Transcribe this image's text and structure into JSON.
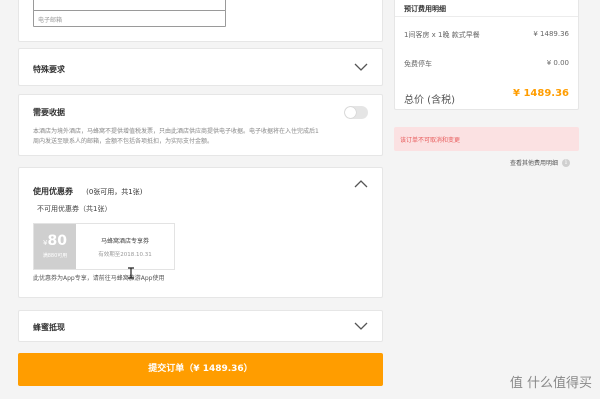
{
  "contact": {
    "email_placeholder": "电子邮箱"
  },
  "special": {
    "title": "特殊要求"
  },
  "receipt": {
    "title": "需要收据",
    "note_line1": "本酒店为境外酒店，马蜂窝不提供增值税发票，只由此酒店供应商提供电子收据。电子收据将在入住完成后1",
    "note_line2": "周内发送至联系人的邮箱，金额不包括各项抵扣，为实际支付金额。"
  },
  "coupon": {
    "title": "使用优惠券",
    "count": "(0张可用，共1张)",
    "unavailable_label": "不可用优惠券（共1张）",
    "ticket_currency": "¥",
    "ticket_amount": "80",
    "ticket_condition": "满880可用",
    "ticket_name": "马蜂窝酒店专享券",
    "ticket_expiry": "有效期至2018.10.31",
    "note": "此优惠券为App专享，请前往马蜂窝旅游App使用"
  },
  "bee": {
    "title": "蜂蜜抵现"
  },
  "submit": {
    "label": "提交订单（¥ 1489.36）"
  },
  "summary": {
    "header": "预订费用明细",
    "room_label": "1间客房 x 1晚  款式早餐",
    "room_price": "¥ 1489.36",
    "parking_label": "免费停车",
    "parking_price": "¥ 0.00",
    "total_label": "总价 (含税)",
    "total_price": "¥ 1489.36",
    "see_other": "查看其他费用明细",
    "info_icon": "i"
  },
  "alert": {
    "text": "该订单不可取消和变更"
  },
  "watermark": {
    "text": "值 什么值得买"
  },
  "colors": {
    "accent": "#ff9d00",
    "alert_bg": "#fbe1e2",
    "alert_text": "#e85c5c"
  }
}
